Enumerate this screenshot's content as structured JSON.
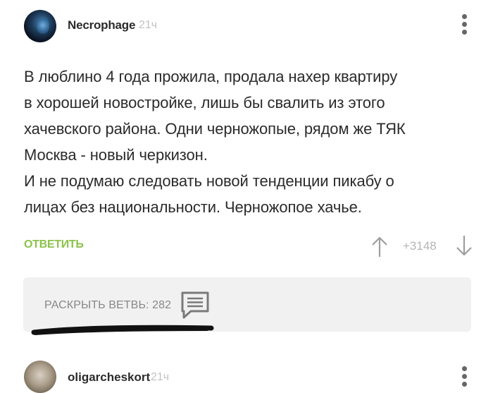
{
  "comment": {
    "author": "Necrophage",
    "time": "21ч",
    "avatar_icon": "masked-figure-avatar",
    "lines": [
      "В люблино 4 года прожила, продала нахер квартиру",
      "в хорошей новостройке, лишь бы свалить из этого",
      "хачевского района. Одни черножопые, рядом же ТЯК",
      "Москва - новый черкизон.",
      "И не подумаю следовать новой тенденции пикабу о",
      "лицах без национальности. Черножопое хачье."
    ],
    "reply_label": "ОТВЕТИТЬ",
    "rating": "+3148",
    "accent_color": "#8bc34a"
  },
  "thread": {
    "expand_label": "РАСКРЫТЬ ВЕТВЬ: 282",
    "icon": "comment-thread-icon"
  },
  "next_comment": {
    "author": "oligarcheskort",
    "time": "21ч"
  }
}
